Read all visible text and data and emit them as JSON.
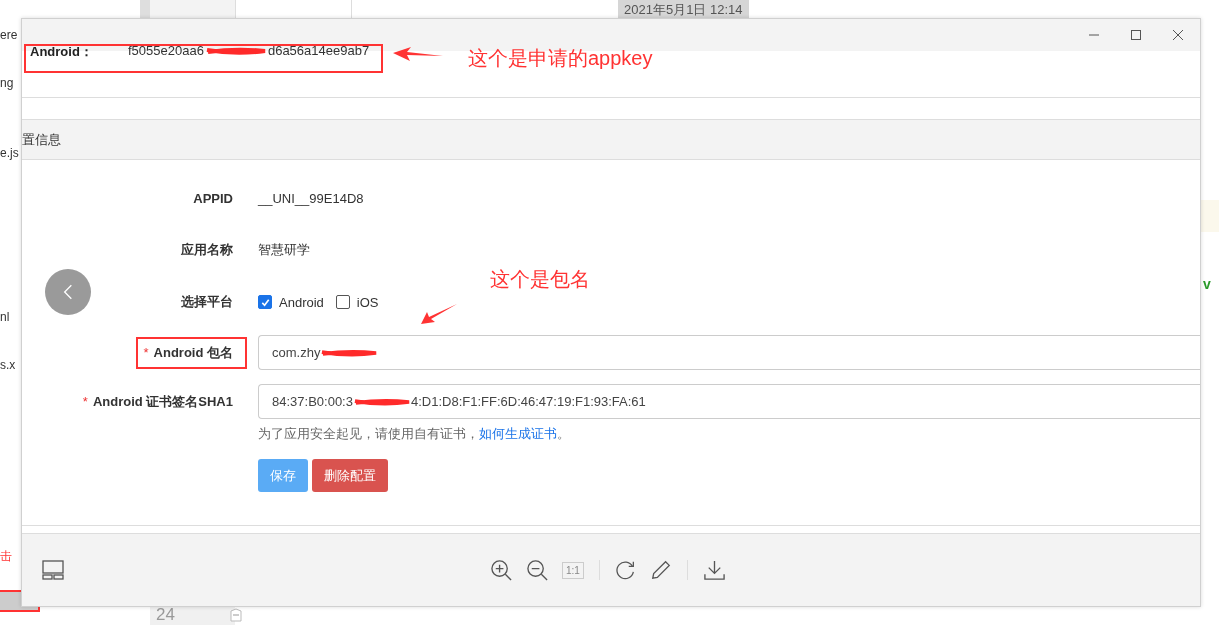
{
  "background": {
    "left_fragments": [
      {
        "text": "ere",
        "kind": "code"
      },
      {
        "text": "ng",
        "kind": "code"
      },
      {
        "text": "e.js",
        "kind": "code"
      },
      {
        "text": "nl",
        "kind": "code"
      },
      {
        "text": "s.x",
        "kind": "code"
      },
      {
        "text": "击",
        "kind": "annotation"
      }
    ],
    "timestamp": "2021年5月1日 12:14",
    "line_number": "24",
    "right_fragment": "v"
  },
  "image": {
    "appkey_label": "Android：",
    "appkey_prefix": "f5055e20aa6",
    "appkey_suffix": "d6a56a14ee9ab7",
    "section_title": "置信息",
    "rows": [
      {
        "kind": "text",
        "label": "APPID",
        "value": "__UNI__99E14D8"
      },
      {
        "kind": "text",
        "label": "应用名称",
        "value": "智慧研学"
      },
      {
        "kind": "platforms",
        "label": "选择平台",
        "options": [
          {
            "label": "Android",
            "checked": true
          },
          {
            "label": "iOS",
            "checked": false
          }
        ]
      },
      {
        "kind": "input",
        "mark": "*",
        "label": "Android 包名",
        "highlighted": true,
        "value_prefix": "com.zhy"
      },
      {
        "kind": "input",
        "mark": "*",
        "label": "Android 证书签名SHA1",
        "highlighted": false,
        "value_prefix": "84:37:B0:00:3",
        "value_suffix": "4:D1:D8:F1:FF:6D:46:47:19:F1:93:FA:61"
      }
    ],
    "hint": "为了应用安全起见，请使用自有证书，",
    "hint_link": "如何生成证书",
    "hint_end": "。",
    "buttons": [
      {
        "label": "保存",
        "kind": "primary"
      },
      {
        "label": "删除配置",
        "kind": "danger"
      }
    ],
    "annotations": [
      {
        "text": "这个是申请的appkey"
      },
      {
        "text": "这个是包名"
      }
    ]
  },
  "toolbar": {
    "actual_size": {
      "label": "1:1",
      "disabled": true
    }
  }
}
